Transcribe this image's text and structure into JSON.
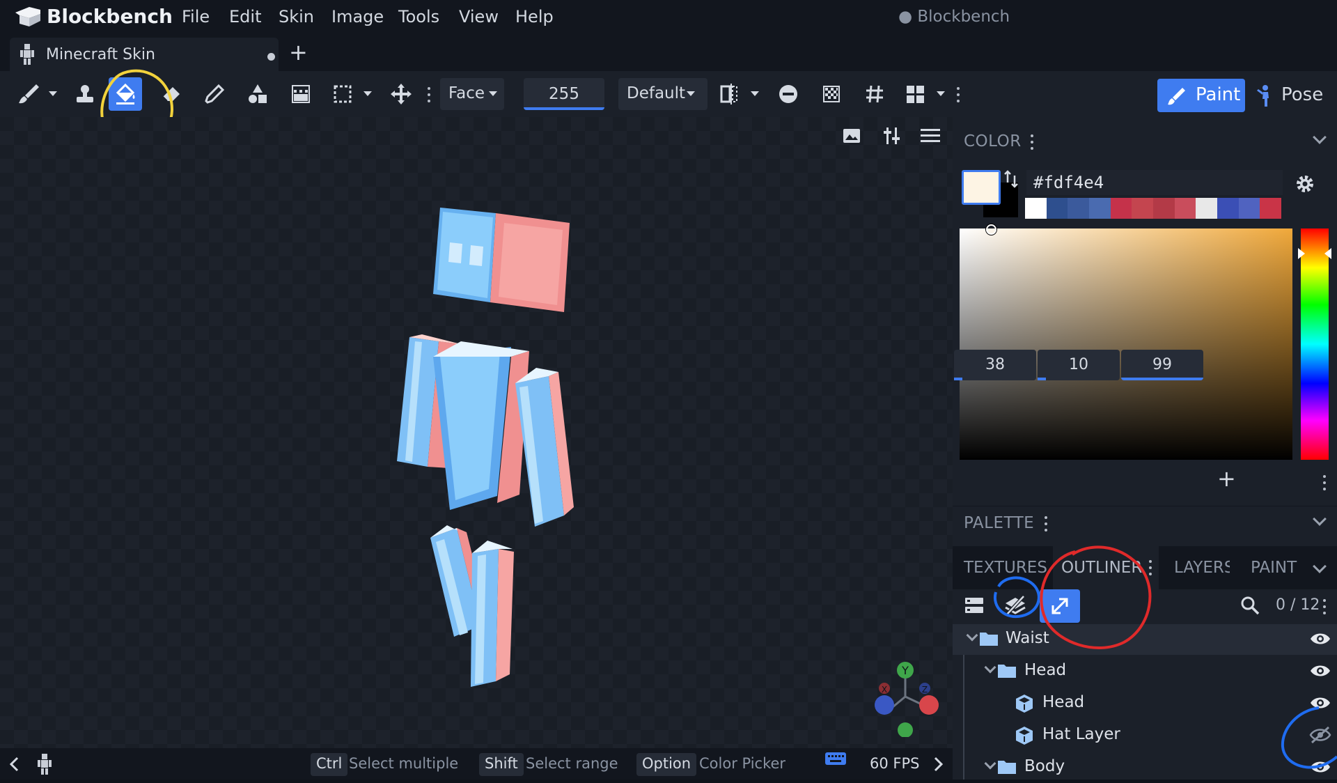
{
  "app": {
    "brand": "Blockbench",
    "window_title": "● Blockbench",
    "menus": [
      "File",
      "Edit",
      "Skin",
      "Image",
      "Tools",
      "View",
      "Help"
    ]
  },
  "tabs": [
    {
      "label": "Minecraft Skin",
      "unsaved": true
    }
  ],
  "toolbar": {
    "tools": [
      "brush-tool",
      "clone-stamp-tool",
      "fill-tool",
      "eraser-tool",
      "color-picker-tool",
      "draw-shape-tool",
      "gradient-tool",
      "selection-tool",
      "move-layer-tool"
    ],
    "active_tool": "fill-tool",
    "fill_mode": "Face",
    "opacity_value": "255",
    "blend_mode": "Default",
    "mode_paint": "Paint",
    "mode_pose": "Pose",
    "active_mode": "Paint"
  },
  "color_panel": {
    "title": "COLOR",
    "hex_value": "#fdf4e4",
    "primary_color": "#fdf4e4",
    "secondary_color": "#000000",
    "history_swatches": [
      "#ffffff",
      "#2e4f8e",
      "#3b5a9c",
      "#4a6bb0",
      "#c5324a",
      "#c4454f",
      "#b33a47",
      "#c94d5c",
      "#e8e8e8",
      "#3b4fb5",
      "#5063c0",
      "#c93447"
    ],
    "hsv": {
      "h": "38",
      "s": "10",
      "v": "99"
    }
  },
  "palette_panel": {
    "title": "PALETTE"
  },
  "outliner": {
    "tabs": [
      "TEXTURES",
      "OUTLINER",
      "LAYERS",
      "PAINT"
    ],
    "active_tab": "OUTLINER",
    "count": "0 / 12",
    "rows": [
      {
        "label": "Waist",
        "type": "group",
        "expanded": true,
        "visible": true,
        "selected": true
      },
      {
        "label": "Head",
        "type": "group",
        "expanded": true,
        "visible": true
      },
      {
        "label": "Head",
        "type": "cube",
        "visible": true
      },
      {
        "label": "Hat Layer",
        "type": "cube",
        "visible": false
      },
      {
        "label": "Body",
        "type": "group",
        "expanded": true,
        "visible": true
      }
    ]
  },
  "status_bar": {
    "hints": [
      {
        "key": "Ctrl",
        "text": "Select multiple"
      },
      {
        "key": "Shift",
        "text": "Select range"
      },
      {
        "key": "Option",
        "text": "Color Picker"
      }
    ],
    "fps": "60 FPS"
  },
  "axis_gizmo": {
    "labels": [
      "Y",
      "X",
      "Z"
    ]
  },
  "annotation_colors": {
    "yellow": "#f2d23c",
    "blue": "#1f6cf0",
    "red": "#e02a2a"
  }
}
